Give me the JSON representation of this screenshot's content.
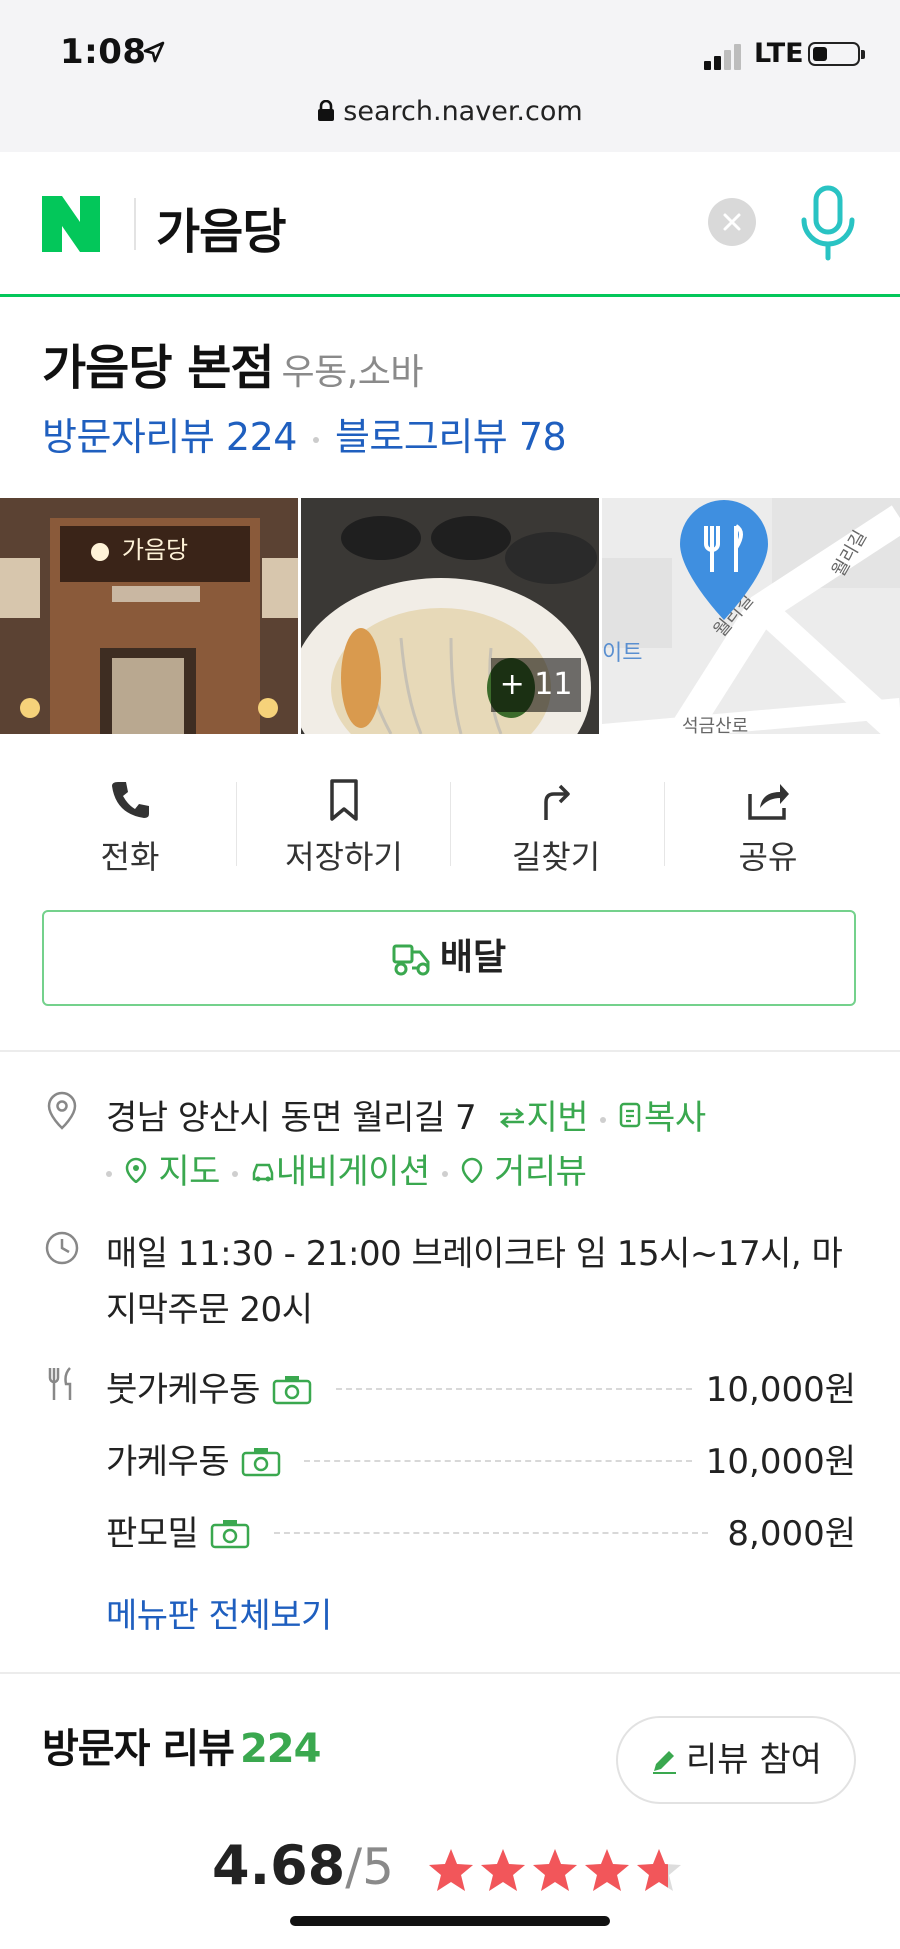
{
  "status_bar": {
    "time": "1:08",
    "network": "LTE"
  },
  "browser": {
    "url": "search.naver.com"
  },
  "search": {
    "query": "가음당"
  },
  "place": {
    "name": "가음당 본점",
    "category": "우동,소바",
    "visitor_review_label": "방문자리뷰",
    "visitor_review_count": "224",
    "blog_review_label": "블로그리뷰",
    "blog_review_count": "78",
    "photo_more": "+ 11",
    "sign_text": "가음당"
  },
  "actions": [
    {
      "label": "전화",
      "icon": "phone-icon"
    },
    {
      "label": "저장하기",
      "icon": "bookmark-icon"
    },
    {
      "label": "길찾기",
      "icon": "directions-icon"
    },
    {
      "label": "공유",
      "icon": "share-icon"
    }
  ],
  "delivery_label": "배달",
  "info": {
    "address": "경남 양산시 동면 월리길 7",
    "address_links": {
      "jibun": "지번",
      "copy": "복사",
      "map": "지도",
      "navigation": "내비게이션",
      "street_view": "거리뷰"
    },
    "hours": "매일 11:30 - 21:00 브레이크타 임 15시~17시, 마지막주문 20시",
    "menu": [
      {
        "name": "붓가케우동",
        "price": "10,000원"
      },
      {
        "name": "가케우동",
        "price": "10,000원"
      },
      {
        "name": "판모밀",
        "price": "8,000원"
      }
    ],
    "menu_all": "메뉴판 전체보기"
  },
  "reviews": {
    "title": "방문자 리뷰",
    "count": "224",
    "write_button": "리뷰 참여",
    "rating": "4.68",
    "rating_max": "/5",
    "stars_value": 4.68
  },
  "map_labels": {
    "street1": "월리길",
    "street2": "월리길",
    "street3": "석금산로",
    "place": "이트"
  },
  "colors": {
    "naver_green": "#03c75a",
    "link_blue": "#1f5fbf",
    "star_red": "#f2565a"
  }
}
